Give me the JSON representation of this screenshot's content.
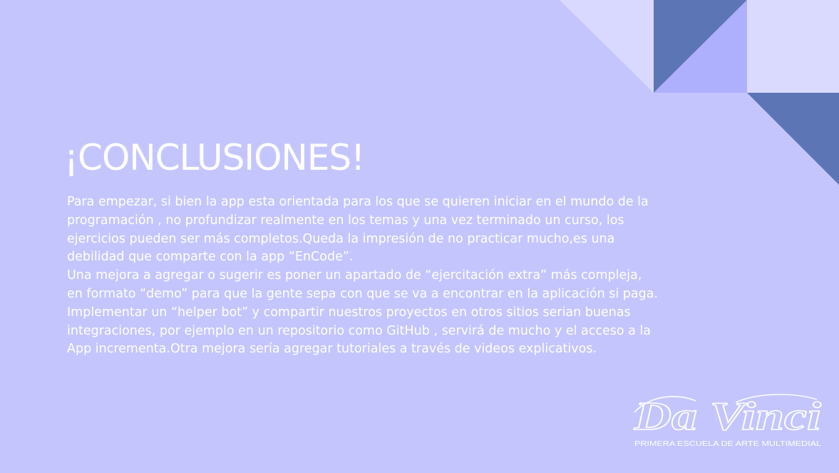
{
  "colors": {
    "background": "#c5c5fe",
    "light_triangle": "#d9d8ff",
    "light_square": "#dadaff",
    "dark_shape": "#5c75b4",
    "mid_triangle": "#afb0fd",
    "text": "#ffffff"
  },
  "slide": {
    "title": "¡CONCLUSIONES!",
    "paragraph_1_lines": [
      "Para empezar, si bien la app esta orientada para los que se quieren iniciar en el mundo de la",
      "programación , no profundizar realmente en los temas y una vez terminado un curso,  los",
      "ejercicios pueden ser más completos.Queda la impresión de no practicar mucho,es una",
      "debilidad que comparte con la app “EnCode”."
    ],
    "paragraph_2_lines": [
      "Una mejora a agregar o sugerir es poner un apartado de “ejercitación extra” más compleja,",
      "en formato “demo” para que la gente sepa con que se va a encontrar en la aplicación si paga.",
      "Implementar un “helper bot” y compartir nuestros proyectos en otros sitios serian buenas",
      "integraciones, por ejemplo en un repositorio como GitHub , servirá de mucho y el acceso a la",
      "App incrementa.Otra mejora sería agregar tutoriales a través de videos explicativos."
    ]
  },
  "logo": {
    "wordmark": "Da Vinci",
    "tagline": "PRIMERA ESCUELA DE ARTE MULTIMEDIAL"
  }
}
